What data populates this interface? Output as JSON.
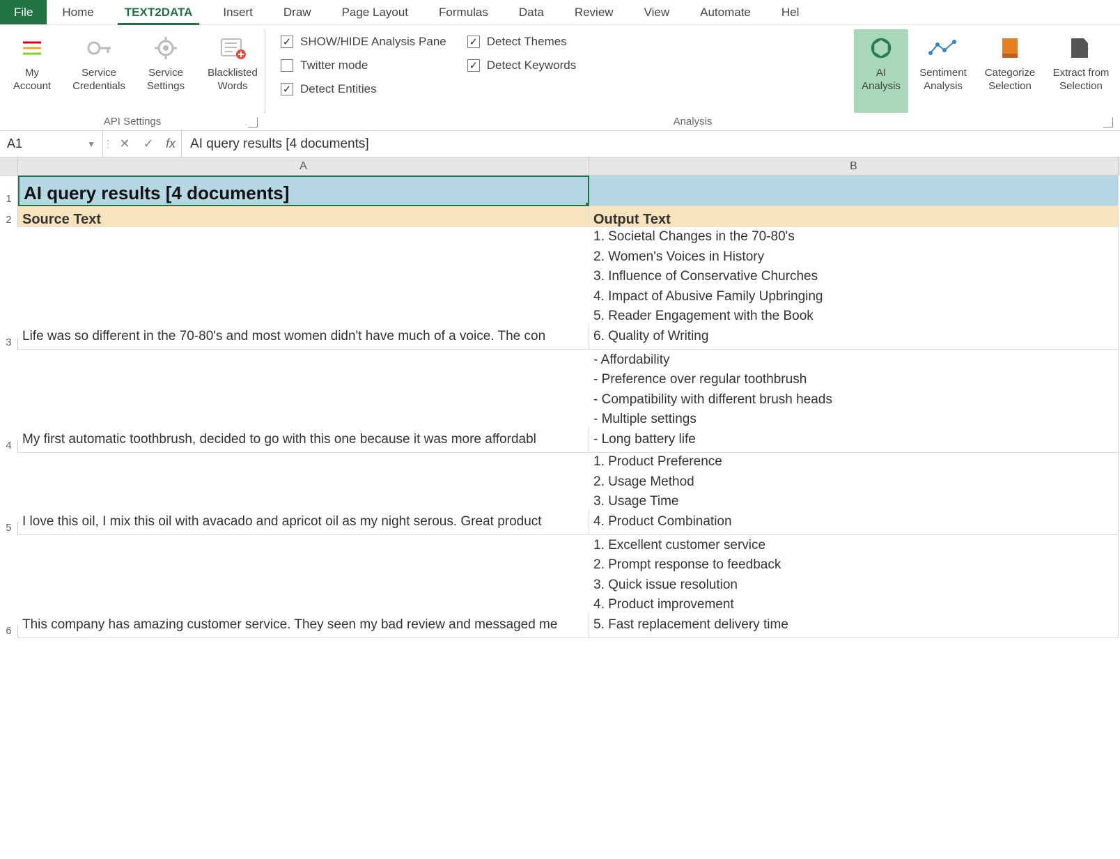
{
  "tabs": {
    "file": "File",
    "items": [
      "Home",
      "TEXT2DATA",
      "Insert",
      "Draw",
      "Page Layout",
      "Formulas",
      "Data",
      "Review",
      "View",
      "Automate",
      "Hel"
    ],
    "active": "TEXT2DATA"
  },
  "ribbon": {
    "api_settings": {
      "label": "API Settings",
      "buttons": [
        {
          "line1": "My",
          "line2": "Account"
        },
        {
          "line1": "Service",
          "line2": "Credentials"
        },
        {
          "line1": "Service",
          "line2": "Settings"
        },
        {
          "line1": "Blacklisted",
          "line2": "Words"
        }
      ]
    },
    "checks": {
      "col1": [
        {
          "label": "SHOW/HIDE Analysis Pane",
          "checked": true
        },
        {
          "label": "Twitter mode",
          "checked": false
        },
        {
          "label": "Detect Entities",
          "checked": true
        }
      ],
      "col2": [
        {
          "label": "Detect Themes",
          "checked": true
        },
        {
          "label": "Detect Keywords",
          "checked": true
        }
      ]
    },
    "analysis": {
      "label": "Analysis",
      "buttons": [
        {
          "line1": "AI",
          "line2": "Analysis",
          "highlight": true
        },
        {
          "line1": "Sentiment",
          "line2": "Analysis"
        },
        {
          "line1": "Categorize",
          "line2": "Selection"
        },
        {
          "line1": "Extract from",
          "line2": "Selection"
        }
      ]
    }
  },
  "formula_bar": {
    "namebox": "A1",
    "content": "AI query results [4 documents]"
  },
  "columns": [
    "A",
    "B"
  ],
  "rows": [
    {
      "n": 1,
      "A": "AI query results [4 documents]",
      "B": ""
    },
    {
      "n": 2,
      "A": "Source Text",
      "B": "Output Text"
    },
    {
      "n": 3,
      "A": "Life was so different in the 70-80's and most women didn't have much of a voice. The con",
      "B": "1. Societal Changes in the 70-80's\n2. Women's Voices in History\n3. Influence of Conservative Churches\n4. Impact of Abusive Family Upbringing\n5. Reader Engagement with the Book\n6. Quality of Writing"
    },
    {
      "n": 4,
      "A": "My first automatic toothbrush, decided to go with this one because it was more affordabl",
      "B": "- Affordability\n- Preference over regular toothbrush\n- Compatibility with different brush heads\n- Multiple settings\n- Long battery life"
    },
    {
      "n": 5,
      "A": "I love this oil, I mix this oil with avacado and apricot oil as my night serous. Great product",
      "B": "1. Product Preference\n2. Usage Method\n3. Usage Time\n4. Product Combination"
    },
    {
      "n": 6,
      "A": "This company has amazing customer service. They seen my bad review and messaged me",
      "B": "1. Excellent customer service\n2. Prompt response to feedback\n3. Quick issue resolution\n4. Product improvement\n5. Fast replacement delivery time"
    }
  ]
}
